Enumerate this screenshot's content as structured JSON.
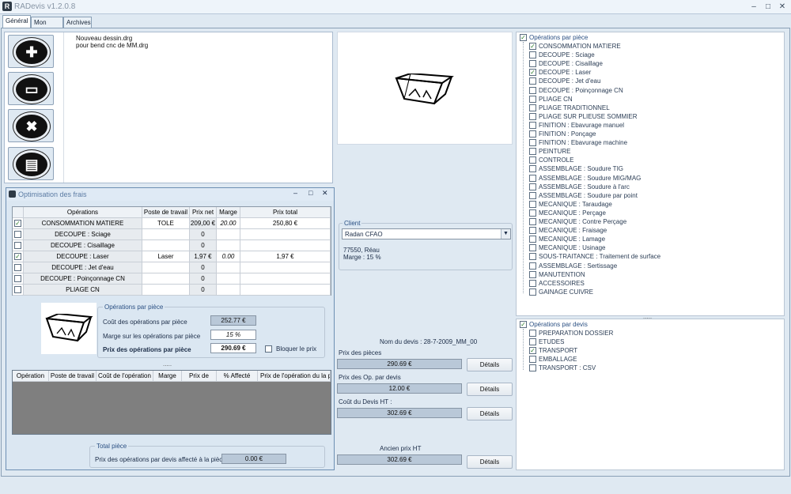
{
  "window": {
    "title": "RADevis v1.2.0.8",
    "app_icon": "radevis-icon"
  },
  "tabs": [
    {
      "label": "Général",
      "active": true
    },
    {
      "label": "Mon devis",
      "active": false
    },
    {
      "label": "Archives",
      "active": false
    }
  ],
  "files": [
    "Nouveau dessin.drg",
    "pour bend cnc de MM.drg"
  ],
  "toolbar_icons": [
    "new-document-icon",
    "open-folder-icon",
    "delete-icon",
    "save-icon"
  ],
  "optim": {
    "title": "Optimisation des frais",
    "columns": [
      "Opérations",
      "Poste de travail",
      "Prix net",
      "Marge",
      "Prix total"
    ],
    "rows": [
      {
        "checked": true,
        "op": "CONSOMMATION MATIERE",
        "poste": "TOLE",
        "net": "209,00 €",
        "marge": "20.00",
        "total": "250,80 €"
      },
      {
        "checked": false,
        "op": "DECOUPE : Sciage",
        "poste": "",
        "net": "0",
        "marge": "",
        "total": ""
      },
      {
        "checked": false,
        "op": "DECOUPE : Cisaillage",
        "poste": "",
        "net": "0",
        "marge": "",
        "total": ""
      },
      {
        "checked": true,
        "op": "DECOUPE : Laser",
        "poste": "Laser",
        "net": "1,97 €",
        "marge": "0.00",
        "total": "1,97 €"
      },
      {
        "checked": false,
        "op": "DECOUPE : Jet d'eau",
        "poste": "",
        "net": "0",
        "marge": "",
        "total": ""
      },
      {
        "checked": false,
        "op": "DECOUPE : Poinçonnage CN",
        "poste": "",
        "net": "0",
        "marge": "",
        "total": ""
      },
      {
        "checked": false,
        "op": "PLIAGE CN",
        "poste": "",
        "net": "0",
        "marge": "",
        "total": ""
      }
    ],
    "ops_group": {
      "title": "Opérations par pièce",
      "cout_label": "Coût des opérations par pièce",
      "cout_value": "252.77 €",
      "marge_label": "Marge sur les opérations par pièce",
      "marge_value": "15 %",
      "prix_label": "Prix des opérations par pièce",
      "prix_value": "290.69 €",
      "bloquer_label": "Bloquer le prix"
    },
    "splitter": ".....",
    "ops_columns": [
      "Opération",
      "Poste de travail",
      "Coût de l'opération",
      "Marge",
      "Prix de",
      "% Affecté",
      "Prix de l'opération du la pièce"
    ],
    "total_group": {
      "title": "Total pièce",
      "label": "Prix des opérations par devis affecté à la pièce",
      "value": "0.00 €"
    }
  },
  "client": {
    "group_title": "Client",
    "selected": "Radan CFAO",
    "address": "77550, Réau",
    "marge_line": "Marge :    15 %"
  },
  "devis": {
    "nom": "Nom du devis : 28-7-2009_MM_00",
    "prix_pieces_label": "Prix des pièces",
    "prix_pieces_value": "290.69 €",
    "prix_op_label": "Prix des Op. par devis",
    "prix_op_value": "12.00 €",
    "cout_label": "Coût du Devis HT :",
    "cout_value": "302.69 €",
    "ancien_label": "Ancien prix HT",
    "ancien_value": "302.69 €",
    "details_label": "Détails"
  },
  "ops_piece": {
    "title": "Opérations par pièce",
    "items": [
      {
        "label": "CONSOMMATION MATIERE",
        "checked": true
      },
      {
        "label": "DECOUPE : Sciage",
        "checked": false
      },
      {
        "label": "DECOUPE : Cisaillage",
        "checked": false
      },
      {
        "label": "DECOUPE : Laser",
        "checked": true
      },
      {
        "label": "DECOUPE : Jet d'eau",
        "checked": false
      },
      {
        "label": "DECOUPE : Poinçonnage CN",
        "checked": false
      },
      {
        "label": "PLIAGE CN",
        "checked": false
      },
      {
        "label": "PLIAGE TRADITIONNEL",
        "checked": false
      },
      {
        "label": "PLIAGE SUR PLIEUSE SOMMIER",
        "checked": false
      },
      {
        "label": "FINITION : Ebavurage manuel",
        "checked": false
      },
      {
        "label": "FINITION : Ponçage",
        "checked": false
      },
      {
        "label": "FINITION : Ebavurage machine",
        "checked": false
      },
      {
        "label": "PEINTURE",
        "checked": false
      },
      {
        "label": "CONTROLE",
        "checked": false
      },
      {
        "label": "ASSEMBLAGE : Soudure TIG",
        "checked": false
      },
      {
        "label": "ASSEMBLAGE : Soudure MIG/MAG",
        "checked": false
      },
      {
        "label": "ASSEMBLAGE : Soudure à l'arc",
        "checked": false
      },
      {
        "label": "ASSEMBLAGE : Soudure par point",
        "checked": false
      },
      {
        "label": "MECANIQUE : Taraudage",
        "checked": false
      },
      {
        "label": "MECANIQUE : Perçage",
        "checked": false
      },
      {
        "label": "MECANIQUE : Contre Perçage",
        "checked": false
      },
      {
        "label": "MECANIQUE : Fraisage",
        "checked": false
      },
      {
        "label": "MECANIQUE : Lamage",
        "checked": false
      },
      {
        "label": "MECANIQUE : Usinage",
        "checked": false
      },
      {
        "label": "SOUS-TRAITANCE : Traitement de surface",
        "checked": false
      },
      {
        "label": "ASSEMBLAGE : Sertissage",
        "checked": false
      },
      {
        "label": "MANUTENTION",
        "checked": false
      },
      {
        "label": "ACCESSOIRES",
        "checked": false
      },
      {
        "label": "GAINAGE CUIVRE",
        "checked": false
      }
    ]
  },
  "ops_devis": {
    "title": "Opérations par devis",
    "items": [
      {
        "label": "PREPARATION DOSSIER",
        "checked": false
      },
      {
        "label": "ETUDES",
        "checked": false
      },
      {
        "label": "TRANSPORT",
        "checked": true
      },
      {
        "label": "EMBALLAGE",
        "checked": false
      },
      {
        "label": "TRANSPORT : CSV",
        "checked": false
      }
    ]
  },
  "splitter_right": "....."
}
